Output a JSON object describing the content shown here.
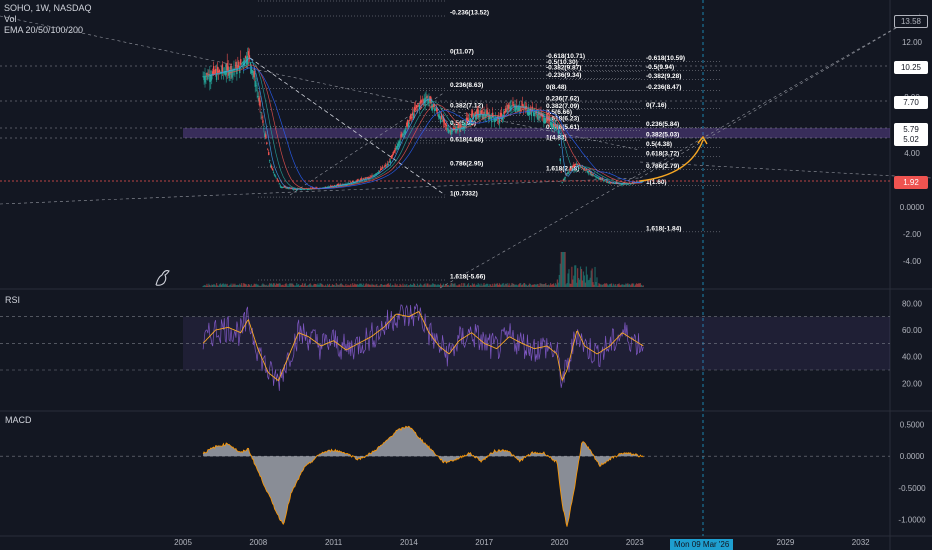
{
  "legend": {
    "symbol": "SOHO, 1W, NASDAQ",
    "vol": "Vol",
    "ema": "EMA 20/50/100/200"
  },
  "rsi_title": "RSI",
  "macd_title": "MACD",
  "crosshair_date": "Mon 09 Mar '26",
  "colors": {
    "background": "#131722",
    "up": "#26a69a",
    "down": "#ef5350",
    "rsi": "#7e57c2",
    "rsi_signal": "#f9a825",
    "zone": "#7e57c2",
    "current_price": "#ef5350",
    "arrow": "#f5a623",
    "crosshair": "#1e9fd0"
  },
  "price_tags": [
    {
      "label": "13.58",
      "bg": "#131722",
      "fg": "#b2b5be",
      "border": "#b2b5be"
    },
    {
      "label": "10.25",
      "bg": "#ffffff",
      "fg": "#131722",
      "border": "#ffffff"
    },
    {
      "label": "7.70",
      "bg": "#ffffff",
      "fg": "#131722",
      "border": "#ffffff"
    },
    {
      "label": "5.79",
      "bg": "#ffffff",
      "fg": "#131722",
      "border": "#ffffff"
    },
    {
      "label": "5.02",
      "bg": "#ffffff",
      "fg": "#131722",
      "border": "#ffffff"
    },
    {
      "label": "1.92",
      "bg": "#ef5350",
      "fg": "#ffffff",
      "border": "#ef5350"
    }
  ],
  "chart_data": [
    {
      "type": "line",
      "pane": "price",
      "title": "",
      "x_ticks": [
        "2005",
        "2008",
        "2011",
        "2014",
        "2017",
        "2020",
        "2023",
        "2029",
        "2032"
      ],
      "y_ticks": [
        "12.00",
        "8.00",
        "4.00",
        "0.0000",
        "-2.00",
        "-4.00"
      ],
      "y_scale": "log",
      "series": [
        {
          "name": "",
          "points": [
            [
              2005.8,
              9.5
            ],
            [
              2006.5,
              9.8
            ],
            [
              2007.2,
              10.1
            ],
            [
              2007.6,
              11.07
            ],
            [
              2007.9,
              9.0
            ],
            [
              2008.2,
              6.0
            ],
            [
              2008.5,
              3.0
            ],
            [
              2008.9,
              1.5
            ],
            [
              2009.5,
              1.3
            ],
            [
              2010.5,
              1.4
            ],
            [
              2011.5,
              1.7
            ],
            [
              2012.5,
              2.2
            ],
            [
              2013.2,
              3.2
            ],
            [
              2013.8,
              5.5
            ],
            [
              2014.3,
              7.2
            ],
            [
              2014.7,
              8.0
            ],
            [
              2015.1,
              7.0
            ],
            [
              2015.6,
              5.6
            ],
            [
              2016.1,
              5.8
            ],
            [
              2016.6,
              6.8
            ],
            [
              2017.1,
              6.7
            ],
            [
              2017.6,
              6.4
            ],
            [
              2018.1,
              7.4
            ],
            [
              2018.6,
              7.2
            ],
            [
              2019.1,
              6.8
            ],
            [
              2019.6,
              6.3
            ],
            [
              2019.95,
              5.7
            ],
            [
              2020.1,
              1.8
            ],
            [
              2020.3,
              2.5
            ],
            [
              2020.7,
              3.2
            ],
            [
              2021.0,
              2.8
            ],
            [
              2021.5,
              2.2
            ],
            [
              2022.0,
              1.8
            ],
            [
              2022.5,
              1.7
            ],
            [
              2023.0,
              1.8
            ],
            [
              2023.35,
              1.92
            ]
          ]
        }
      ],
      "fib_labels": [
        "-0.236(13.52)",
        "0(11.07)",
        "0.236(8.63)",
        "0.382(7.12)",
        "0.5(5.90)",
        "0.618(4.68)",
        "0.786(2.95)",
        "1(0.7332)",
        "1.618(-5.66)",
        "-0.618(10.71)",
        "-0.5(10.30)",
        "-0.382(9.87)",
        "-0.236(9.34)",
        "0(8.48)",
        "0.236(7.62)",
        "0.382(7.09)",
        "0.5(6.66)",
        "0.618(6.23)",
        "0.786(5.61)",
        "1(4.83)",
        "1.618(2.58)",
        "-0.618(10.59)",
        "-0.5(9.94)",
        "-0.382(9.28)",
        "-0.236(8.47)",
        "0(7.16)",
        "0.236(5.84)",
        "0.382(5.03)",
        "0.5(4.38)",
        "0.618(3.72)",
        "0.786(2.79)",
        "1(1.60)",
        "1.618(-1.84)"
      ],
      "target_zone": [
        5.02,
        5.79
      ],
      "current_price": 1.92
    },
    {
      "type": "line",
      "pane": "rsi",
      "title": "",
      "y_ticks": [
        "80.00",
        "60.00",
        "40.00",
        "20.00"
      ],
      "ylim": [
        0,
        90
      ],
      "bands": [
        30,
        50,
        70
      ],
      "series": [
        {
          "name": "",
          "points": [
            [
              2005.8,
              50
            ],
            [
              2006.3,
              60
            ],
            [
              2006.8,
              62
            ],
            [
              2007.3,
              58
            ],
            [
              2007.6,
              68
            ],
            [
              2008.0,
              45
            ],
            [
              2008.4,
              28
            ],
            [
              2008.8,
              22
            ],
            [
              2009.2,
              40
            ],
            [
              2009.6,
              58
            ],
            [
              2010.0,
              55
            ],
            [
              2010.5,
              48
            ],
            [
              2011.0,
              52
            ],
            [
              2011.5,
              45
            ],
            [
              2012.0,
              50
            ],
            [
              2012.5,
              55
            ],
            [
              2013.0,
              62
            ],
            [
              2013.5,
              72
            ],
            [
              2014.0,
              70
            ],
            [
              2014.4,
              74
            ],
            [
              2014.8,
              58
            ],
            [
              2015.2,
              48
            ],
            [
              2015.6,
              42
            ],
            [
              2016.0,
              52
            ],
            [
              2016.5,
              58
            ],
            [
              2017.0,
              50
            ],
            [
              2017.5,
              46
            ],
            [
              2018.0,
              55
            ],
            [
              2018.5,
              50
            ],
            [
              2019.0,
              46
            ],
            [
              2019.5,
              48
            ],
            [
              2019.9,
              42
            ],
            [
              2020.1,
              22
            ],
            [
              2020.3,
              30
            ],
            [
              2020.7,
              60
            ],
            [
              2021.0,
              48
            ],
            [
              2021.5,
              42
            ],
            [
              2022.0,
              48
            ],
            [
              2022.5,
              58
            ],
            [
              2023.0,
              52
            ],
            [
              2023.35,
              48
            ]
          ]
        }
      ]
    },
    {
      "type": "area",
      "pane": "macd",
      "title": "",
      "y_ticks": [
        "0.5000",
        "0.0000",
        "-0.5000",
        "-1.0000"
      ],
      "ylim": [
        -1.2,
        0.7
      ],
      "series": [
        {
          "name": "",
          "points": [
            [
              2005.8,
              0.05
            ],
            [
              2006.3,
              0.15
            ],
            [
              2006.8,
              0.2
            ],
            [
              2007.3,
              0.05
            ],
            [
              2007.6,
              0.12
            ],
            [
              2008.0,
              -0.25
            ],
            [
              2008.4,
              -0.6
            ],
            [
              2008.8,
              -0.95
            ],
            [
              2009.0,
              -1.08
            ],
            [
              2009.3,
              -0.6
            ],
            [
              2009.8,
              -0.2
            ],
            [
              2010.5,
              0.05
            ],
            [
              2011.0,
              0.1
            ],
            [
              2011.5,
              0.05
            ],
            [
              2012.0,
              -0.05
            ],
            [
              2012.5,
              0.05
            ],
            [
              2013.0,
              0.2
            ],
            [
              2013.5,
              0.4
            ],
            [
              2014.0,
              0.48
            ],
            [
              2014.4,
              0.3
            ],
            [
              2014.9,
              0.1
            ],
            [
              2015.4,
              -0.1
            ],
            [
              2015.9,
              -0.05
            ],
            [
              2016.4,
              0.05
            ],
            [
              2016.9,
              -0.08
            ],
            [
              2017.4,
              0.08
            ],
            [
              2017.9,
              0.1
            ],
            [
              2018.4,
              -0.08
            ],
            [
              2018.9,
              0.05
            ],
            [
              2019.4,
              0.05
            ],
            [
              2019.9,
              -0.1
            ],
            [
              2020.1,
              -0.75
            ],
            [
              2020.3,
              -1.12
            ],
            [
              2020.6,
              -0.5
            ],
            [
              2020.9,
              0.25
            ],
            [
              2021.2,
              0.1
            ],
            [
              2021.6,
              -0.15
            ],
            [
              2022.0,
              -0.05
            ],
            [
              2022.5,
              0.05
            ],
            [
              2023.0,
              0.03
            ],
            [
              2023.35,
              -0.02
            ]
          ]
        }
      ]
    }
  ]
}
